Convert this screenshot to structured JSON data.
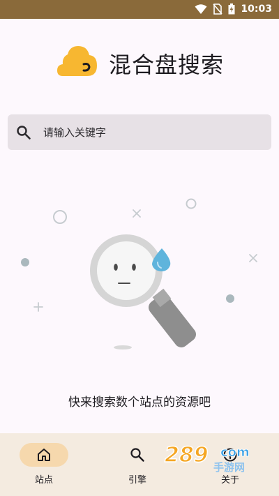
{
  "status_bar": {
    "time": "10:03"
  },
  "app": {
    "title": "混合盘搜索"
  },
  "search": {
    "placeholder": "请输入关键字"
  },
  "empty_state": {
    "message": "快来搜索数个站点的资源吧"
  },
  "bottom_nav": {
    "items": [
      {
        "label": "站点",
        "icon": "home-icon",
        "active": true
      },
      {
        "label": "引擎",
        "icon": "search-icon",
        "active": false
      },
      {
        "label": "关于",
        "icon": "info-icon",
        "active": false
      }
    ]
  },
  "watermark": {
    "text": "289 com",
    "subtext": "手游网"
  },
  "colors": {
    "accent": "#f6d8ad",
    "logo": "#f7b731",
    "status_bar": "#8a6a3a",
    "nav_background": "#f4ebe0"
  }
}
